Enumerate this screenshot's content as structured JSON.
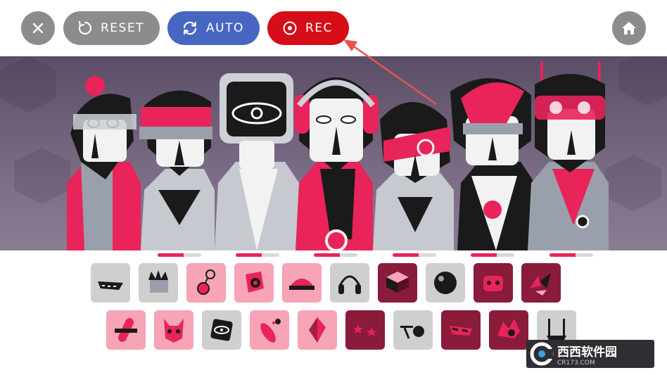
{
  "toolbar": {
    "reset_label": "RESET",
    "auto_label": "AUTO",
    "rec_label": "REC",
    "colors": {
      "close": "#8c8c8c",
      "reset": "#8c8c8c",
      "auto": "#4766c2",
      "rec": "#d50e1a",
      "home": "#8c8c8c"
    },
    "icons": {
      "close": "close-icon",
      "reset": "reset-icon",
      "auto": "auto-icon",
      "rec": "record-icon",
      "home": "home-icon"
    }
  },
  "stage": {
    "character_count": 7,
    "palette": {
      "accent": "#e8245a",
      "dark": "#1a1a1a",
      "gray": "#9aa0ab"
    }
  },
  "meters": [
    {
      "index": 1,
      "level": 0.6
    },
    {
      "index": 2,
      "level": 0.6
    },
    {
      "index": 3,
      "level": 0.6
    },
    {
      "index": 4,
      "level": 0.6
    },
    {
      "index": 5,
      "level": 0.6
    },
    {
      "index": 6,
      "level": 0.6
    }
  ],
  "sound_icons": {
    "row1": [
      {
        "name": "sound-icon-visor",
        "style": "gray"
      },
      {
        "name": "sound-icon-spiky-hair",
        "style": "gray"
      },
      {
        "name": "sound-icon-pendant",
        "style": "pink"
      },
      {
        "name": "sound-icon-gem",
        "style": "pink"
      },
      {
        "name": "sound-icon-cap",
        "style": "pink"
      },
      {
        "name": "sound-icon-headphones",
        "style": "gray"
      },
      {
        "name": "sound-icon-box-visor",
        "style": "dark"
      },
      {
        "name": "sound-icon-ball",
        "style": "gray"
      },
      {
        "name": "sound-icon-mask",
        "style": "dark"
      },
      {
        "name": "sound-icon-shards",
        "style": "dark"
      }
    ],
    "row2": [
      {
        "name": "sound-icon-tilted-bar",
        "style": "pink"
      },
      {
        "name": "sound-icon-fox-mask",
        "style": "pink"
      },
      {
        "name": "sound-icon-eye-card",
        "style": "gray"
      },
      {
        "name": "sound-icon-feather",
        "style": "pink"
      },
      {
        "name": "sound-icon-crystal",
        "style": "pink"
      },
      {
        "name": "sound-icon-stars",
        "style": "dark"
      },
      {
        "name": "sound-icon-glasses",
        "style": "gray"
      },
      {
        "name": "sound-icon-shades",
        "style": "dark"
      },
      {
        "name": "sound-icon-hair-flare",
        "style": "dark"
      },
      {
        "name": "sound-icon-antenna",
        "style": "gray"
      }
    ]
  },
  "watermark": {
    "main_text": "西西软件园",
    "sub_text": "CR173.COM"
  }
}
